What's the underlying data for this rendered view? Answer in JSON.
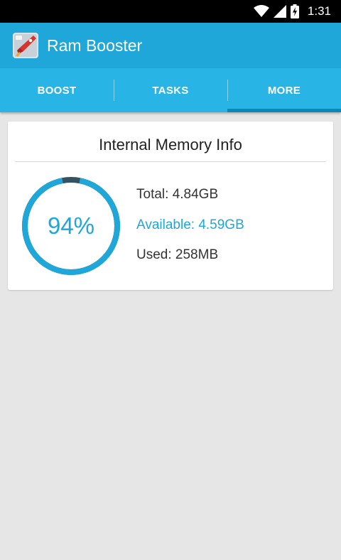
{
  "status_bar": {
    "time": "1:31"
  },
  "app_bar": {
    "title": "Ram Booster"
  },
  "tabs": [
    {
      "label": "BOOST",
      "active": false
    },
    {
      "label": "TASKS",
      "active": false
    },
    {
      "label": "MORE",
      "active": true
    }
  ],
  "memory_card": {
    "title": "Internal Memory Info",
    "percent_label": "94%",
    "available_fraction": 0.94,
    "total": "Total: 4.84GB",
    "available": "Available: 4.59GB",
    "used": "Used: 258MB"
  },
  "colors": {
    "primary": "#1ea7d8",
    "tab_bar": "#29b4e6",
    "tab_indicator": "#0d86b3",
    "gauge_used": "#34525f",
    "background": "#e6e6e6"
  }
}
